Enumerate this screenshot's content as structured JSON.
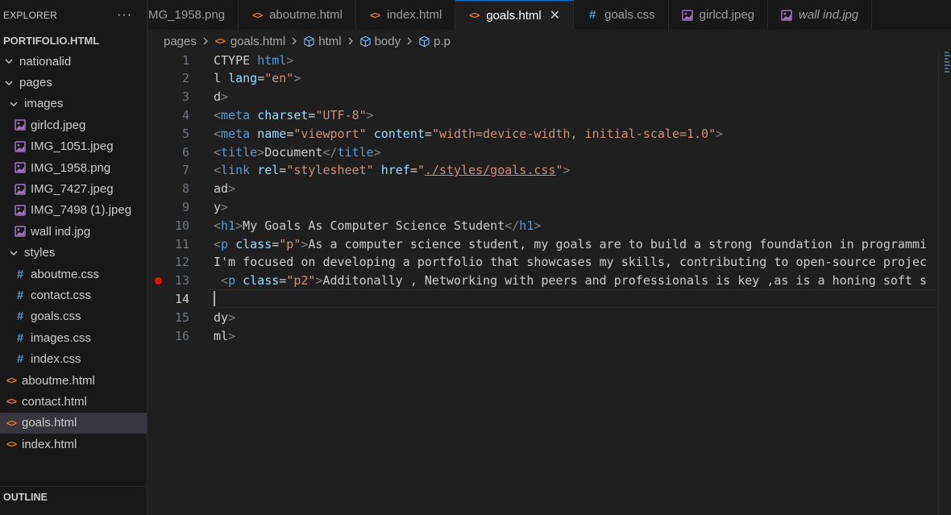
{
  "explorer": {
    "title": "EXPLORER",
    "more": "···",
    "project": "PORTIFOLIO.HTML",
    "tree": [
      {
        "label": "nationalid",
        "type": "folder",
        "indent": 0,
        "open": false
      },
      {
        "label": "pages",
        "type": "folder",
        "indent": 0,
        "open": true
      },
      {
        "label": "images",
        "type": "folder",
        "indent": 1,
        "open": true
      },
      {
        "label": "girlcd.jpeg",
        "type": "img",
        "indent": 2
      },
      {
        "label": "IMG_1051.jpeg",
        "type": "img",
        "indent": 2
      },
      {
        "label": "IMG_1958.png",
        "type": "img",
        "indent": 2
      },
      {
        "label": "IMG_7427.jpeg",
        "type": "img",
        "indent": 2
      },
      {
        "label": "IMG_7498 (1).jpeg",
        "type": "img",
        "indent": 2
      },
      {
        "label": "wall ind.jpg",
        "type": "img",
        "indent": 2
      },
      {
        "label": "styles",
        "type": "folder",
        "indent": 1,
        "open": true
      },
      {
        "label": "aboutme.css",
        "type": "css",
        "indent": 2
      },
      {
        "label": "contact.css",
        "type": "css",
        "indent": 2
      },
      {
        "label": "goals.css",
        "type": "css",
        "indent": 2
      },
      {
        "label": "images.css",
        "type": "css",
        "indent": 2
      },
      {
        "label": "index.css",
        "type": "css",
        "indent": 2
      },
      {
        "label": "aboutme.html",
        "type": "html",
        "indent": 1
      },
      {
        "label": "contact.html",
        "type": "html",
        "indent": 1
      },
      {
        "label": "goals.html",
        "type": "html",
        "indent": 1,
        "selected": true
      },
      {
        "label": "index.html",
        "type": "html",
        "indent": 1
      }
    ],
    "outline": "OUTLINE"
  },
  "tabs": [
    {
      "label": "MG_1958.png",
      "type": "img",
      "active": false,
      "italic": false
    },
    {
      "label": "aboutme.html",
      "type": "html",
      "active": false,
      "italic": false
    },
    {
      "label": "index.html",
      "type": "html",
      "active": false,
      "italic": false
    },
    {
      "label": "goals.html",
      "type": "html",
      "active": true,
      "italic": false
    },
    {
      "label": "goals.css",
      "type": "css",
      "active": false,
      "italic": false
    },
    {
      "label": "girlcd.jpeg",
      "type": "img",
      "active": false,
      "italic": false
    },
    {
      "label": "wall ind.jpg",
      "type": "img",
      "active": false,
      "italic": true
    }
  ],
  "tab_close": "✕",
  "breadcrumb": [
    {
      "label": "pages",
      "icon": "none"
    },
    {
      "label": "goals.html",
      "icon": "html"
    },
    {
      "label": "html",
      "icon": "cube"
    },
    {
      "label": "body",
      "icon": "cube"
    },
    {
      "label": "p.p",
      "icon": "cube"
    }
  ],
  "editor": {
    "current_line": 14,
    "breakpoint_line": 13,
    "lines": [
      {
        "n": "1",
        "tokens": [
          [
            "t-txt",
            "CTYPE "
          ],
          [
            "t-tag",
            "html"
          ],
          [
            "t-br",
            ">"
          ]
        ]
      },
      {
        "n": "2",
        "tokens": [
          [
            "t-txt",
            "l "
          ],
          [
            "t-attr",
            "lang"
          ],
          [
            "t-txt",
            "="
          ],
          [
            "t-str",
            "\"en\""
          ],
          [
            "t-br",
            ">"
          ]
        ]
      },
      {
        "n": "3",
        "tokens": [
          [
            "t-txt",
            "d"
          ],
          [
            "t-br",
            ">"
          ]
        ]
      },
      {
        "n": "4",
        "tokens": [
          [
            "t-br",
            "<"
          ],
          [
            "t-tag",
            "meta "
          ],
          [
            "t-attr",
            "charset"
          ],
          [
            "t-txt",
            "="
          ],
          [
            "t-str",
            "\"UTF-8\""
          ],
          [
            "t-br",
            ">"
          ]
        ]
      },
      {
        "n": "5",
        "tokens": [
          [
            "t-br",
            "<"
          ],
          [
            "t-tag",
            "meta "
          ],
          [
            "t-attr",
            "name"
          ],
          [
            "t-txt",
            "="
          ],
          [
            "t-str",
            "\"viewport\" "
          ],
          [
            "t-attr",
            "content"
          ],
          [
            "t-txt",
            "="
          ],
          [
            "t-str",
            "\"width=device-width, initial-scale=1.0\""
          ],
          [
            "t-br",
            ">"
          ]
        ]
      },
      {
        "n": "6",
        "tokens": [
          [
            "t-br",
            "<"
          ],
          [
            "t-tag",
            "title"
          ],
          [
            "t-br",
            ">"
          ],
          [
            "t-txt",
            "Document"
          ],
          [
            "t-br",
            "</"
          ],
          [
            "t-tag",
            "title"
          ],
          [
            "t-br",
            ">"
          ]
        ]
      },
      {
        "n": "7",
        "tokens": [
          [
            "t-br",
            "<"
          ],
          [
            "t-tag",
            "link "
          ],
          [
            "t-attr",
            "rel"
          ],
          [
            "t-txt",
            "="
          ],
          [
            "t-str",
            "\"stylesheet\" "
          ],
          [
            "t-attr",
            "href"
          ],
          [
            "t-txt",
            "="
          ],
          [
            "t-str",
            "\""
          ],
          [
            "t-link",
            "./styles/goals.css"
          ],
          [
            "t-str",
            "\""
          ],
          [
            "t-br",
            ">"
          ]
        ]
      },
      {
        "n": "8",
        "tokens": [
          [
            "t-txt",
            "ad"
          ],
          [
            "t-br",
            ">"
          ]
        ]
      },
      {
        "n": "9",
        "tokens": [
          [
            "t-txt",
            "y"
          ],
          [
            "t-br",
            ">"
          ]
        ]
      },
      {
        "n": "10",
        "tokens": [
          [
            "t-br",
            "<"
          ],
          [
            "t-tag",
            "h1"
          ],
          [
            "t-br",
            ">"
          ],
          [
            "t-txt",
            "My Goals As Computer Science Student"
          ],
          [
            "t-br",
            "</"
          ],
          [
            "t-tag",
            "h1"
          ],
          [
            "t-br",
            ">"
          ]
        ]
      },
      {
        "n": "11",
        "tokens": [
          [
            "t-br",
            "<"
          ],
          [
            "t-tag",
            "p "
          ],
          [
            "t-attr",
            "class"
          ],
          [
            "t-txt",
            "="
          ],
          [
            "t-str",
            "\"p\""
          ],
          [
            "t-br",
            ">"
          ],
          [
            "t-txt",
            "As a computer science student, my goals are to build a strong foundation in programmi"
          ]
        ]
      },
      {
        "n": "12",
        "tokens": [
          [
            "t-txt",
            "I'm focused on developing a portfolio that showcases my skills, contributing to open-source projec"
          ]
        ]
      },
      {
        "n": "13",
        "tokens": [
          [
            "t-txt",
            " "
          ],
          [
            "t-br",
            "<"
          ],
          [
            "t-tag",
            "p "
          ],
          [
            "t-attr",
            "class"
          ],
          [
            "t-txt",
            "="
          ],
          [
            "t-str",
            "\"p2\""
          ],
          [
            "t-br",
            ">"
          ],
          [
            "t-txt",
            "Additonally , Networking with peers and professionals is key ,as is a honing soft s"
          ]
        ]
      },
      {
        "n": "14",
        "tokens": []
      },
      {
        "n": "15",
        "tokens": [
          [
            "t-txt",
            "dy"
          ],
          [
            "t-br",
            ">"
          ]
        ]
      },
      {
        "n": "16",
        "tokens": [
          [
            "t-txt",
            "ml"
          ],
          [
            "t-br",
            ">"
          ]
        ]
      }
    ]
  },
  "colors": {
    "accent": "#0078d4",
    "breakpoint": "#e51400",
    "tag": "#569cd6",
    "attr": "#9cdcfe",
    "string": "#ce9178"
  }
}
